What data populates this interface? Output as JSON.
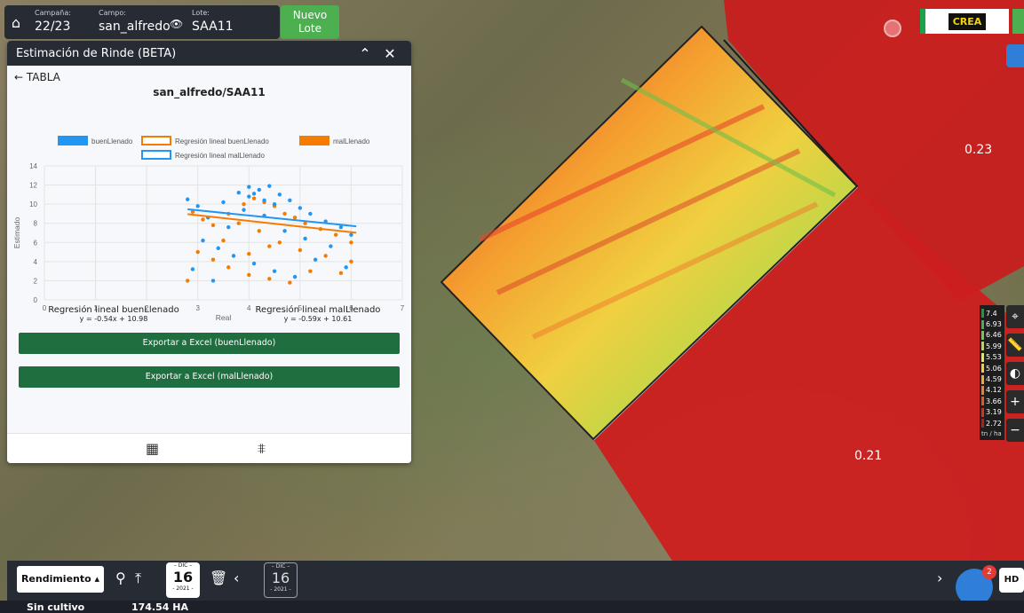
{
  "topbar": {
    "campana_label": "Campaña:",
    "campana_value": "22/23",
    "campo_label": "Campo:",
    "campo_value": "san_alfredo",
    "lote_label": "Lote:",
    "lote_value": "SAA11",
    "nuevo_lote": "Nuevo Lote"
  },
  "brand": {
    "logo_text": "CREA"
  },
  "map": {
    "label_a": "0.23",
    "label_b": "0.21"
  },
  "legend": {
    "values": [
      "7.4",
      "6.93",
      "6.46",
      "5.99",
      "5.53",
      "5.06",
      "4.59",
      "4.12",
      "3.66",
      "3.19",
      "2.72"
    ],
    "colors": [
      "#1a9a3a",
      "#47b04a",
      "#7cc24c",
      "#b8d84e",
      "#e8e64a",
      "#f4cd3e",
      "#f4a832",
      "#ee8028",
      "#e25a22",
      "#d4341c",
      "#b71c1c"
    ],
    "unit": "tn / ha"
  },
  "panel": {
    "title": "Estimación de Rinde (BETA)",
    "back_label": "← TABLA",
    "export_buen": "Exportar a Excel (buenLlenado)",
    "export_mal": "Exportar a Excel (malLlenado)",
    "eq_buen_title": "Regresión lineal buenLlenado",
    "eq_buen_formula": "y = -0.54x + 10.98",
    "eq_mal_title": "Regresión lineal malLlenado",
    "eq_mal_formula": "y = -0.59x + 10.61"
  },
  "chart_data": {
    "type": "scatter",
    "title": "san_alfredo/SAA11",
    "xlabel": "Real",
    "ylabel": "Estimado",
    "xlim": [
      0,
      7
    ],
    "ylim": [
      0,
      14
    ],
    "xticks": [
      0,
      1,
      2,
      3,
      4,
      5,
      6,
      7
    ],
    "yticks": [
      0,
      2,
      4,
      6,
      8,
      10,
      12,
      14
    ],
    "grid": true,
    "legend_position": "top",
    "legend": [
      "buenLlenado",
      "Regresión lineal buenLlenado",
      "malLlenado",
      "Regresión lineal malLlenado"
    ],
    "series": [
      {
        "name": "buenLlenado",
        "color": "#2196f3",
        "points": [
          [
            2.8,
            10.5
          ],
          [
            3.0,
            9.8
          ],
          [
            3.2,
            8.6
          ],
          [
            3.5,
            10.2
          ],
          [
            3.8,
            11.2
          ],
          [
            4.0,
            11.8
          ],
          [
            4.2,
            11.5
          ],
          [
            4.4,
            11.9
          ],
          [
            4.6,
            11.0
          ],
          [
            4.8,
            10.4
          ],
          [
            5.0,
            9.6
          ],
          [
            5.2,
            9.0
          ],
          [
            5.5,
            8.2
          ],
          [
            5.8,
            7.6
          ],
          [
            6.0,
            6.8
          ],
          [
            3.1,
            6.2
          ],
          [
            3.4,
            5.4
          ],
          [
            3.7,
            4.6
          ],
          [
            4.1,
            3.8
          ],
          [
            4.5,
            3.0
          ],
          [
            4.9,
            2.4
          ],
          [
            5.3,
            4.2
          ],
          [
            5.6,
            5.6
          ],
          [
            5.9,
            3.4
          ],
          [
            3.6,
            7.6
          ],
          [
            4.3,
            8.8
          ],
          [
            4.7,
            7.2
          ],
          [
            5.1,
            6.4
          ],
          [
            3.9,
            9.4
          ],
          [
            4.0,
            10.8
          ],
          [
            4.5,
            10.0
          ],
          [
            4.1,
            11.1
          ],
          [
            4.3,
            10.4
          ],
          [
            3.3,
            2.0
          ],
          [
            2.9,
            3.2
          ]
        ]
      },
      {
        "name": "malLlenado",
        "color": "#f57c00",
        "points": [
          [
            2.9,
            9.2
          ],
          [
            3.1,
            8.4
          ],
          [
            3.3,
            7.8
          ],
          [
            3.6,
            9.0
          ],
          [
            3.9,
            10.0
          ],
          [
            4.1,
            10.6
          ],
          [
            4.3,
            10.2
          ],
          [
            4.5,
            9.8
          ],
          [
            4.7,
            9.0
          ],
          [
            4.9,
            8.6
          ],
          [
            5.1,
            8.0
          ],
          [
            5.4,
            7.4
          ],
          [
            5.7,
            6.8
          ],
          [
            6.0,
            6.0
          ],
          [
            3.0,
            5.0
          ],
          [
            3.3,
            4.2
          ],
          [
            3.6,
            3.4
          ],
          [
            4.0,
            2.6
          ],
          [
            4.4,
            2.2
          ],
          [
            4.8,
            1.8
          ],
          [
            5.2,
            3.0
          ],
          [
            5.5,
            4.6
          ],
          [
            5.8,
            2.8
          ],
          [
            3.5,
            6.2
          ],
          [
            4.2,
            7.2
          ],
          [
            4.6,
            6.0
          ],
          [
            5.0,
            5.2
          ],
          [
            3.8,
            8.0
          ],
          [
            4.0,
            4.8
          ],
          [
            4.4,
            5.6
          ],
          [
            2.8,
            2.0
          ],
          [
            6.0,
            4.0
          ]
        ]
      }
    ],
    "regressions": [
      {
        "name": "Regresión lineal buenLlenado",
        "slope": -0.54,
        "intercept": 10.98,
        "color": "#2196f3"
      },
      {
        "name": "Regresión lineal malLlenado",
        "slope": -0.59,
        "intercept": 10.61,
        "color": "#f57c00"
      }
    ]
  },
  "bottombar": {
    "layer": "Rendimiento ▴",
    "date1": {
      "month": "– DIC –",
      "day": "16",
      "year": "- 2021 -"
    },
    "date2": {
      "month": "– DIC –",
      "day": "16",
      "year": "- 2021 -"
    },
    "hd": "HD",
    "chat_badge": "2"
  },
  "status": {
    "cultivo": "Sin cultivo",
    "area": "174.54 HA"
  }
}
